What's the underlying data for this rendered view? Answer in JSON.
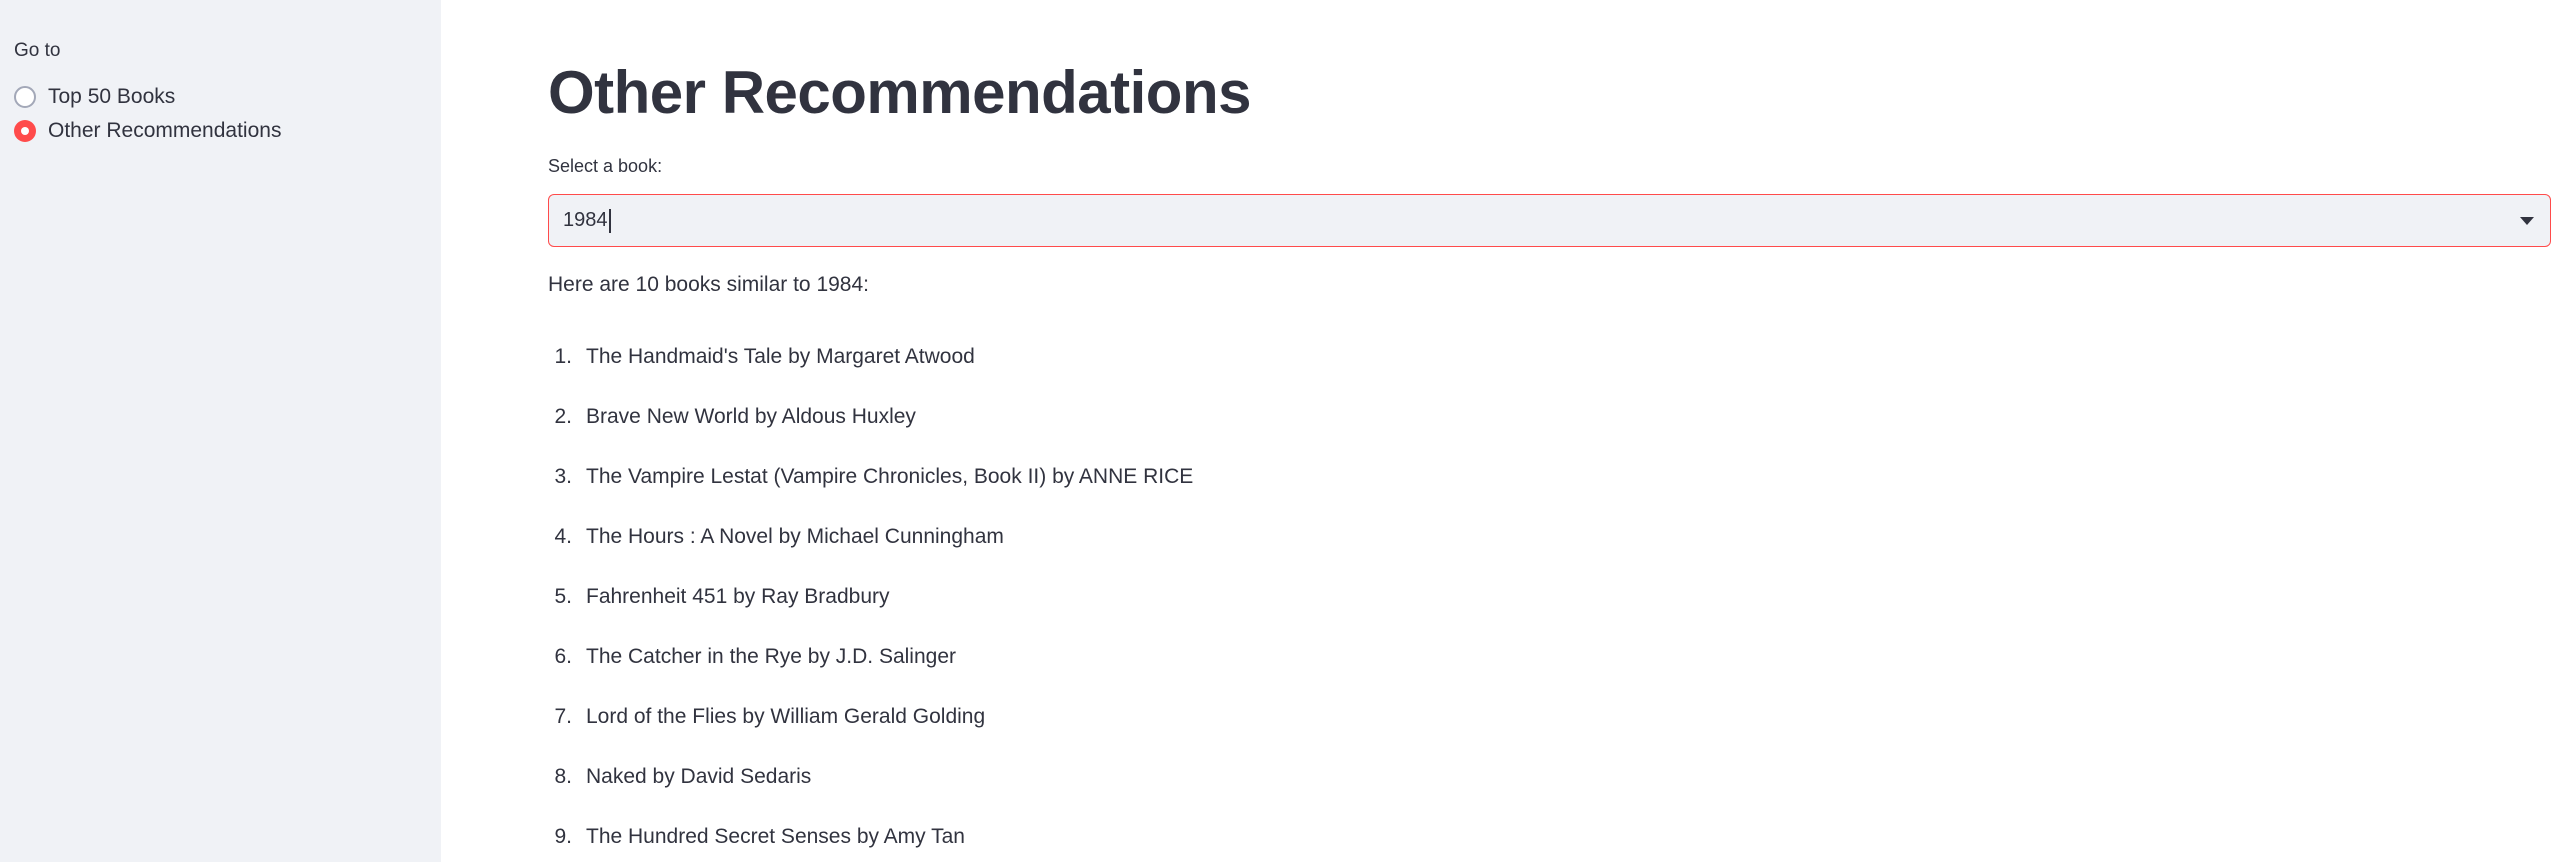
{
  "sidebar": {
    "label": "Go to",
    "options": [
      {
        "label": "Top 50 Books",
        "selected": false
      },
      {
        "label": "Other Recommendations",
        "selected": true
      }
    ]
  },
  "main": {
    "title": "Other Recommendations",
    "select_label": "Select a book:",
    "select_value": "1984",
    "intro": "Here are 10 books similar to 1984:",
    "recommendations": [
      {
        "num": "1.",
        "text": "The Handmaid's Tale by Margaret Atwood"
      },
      {
        "num": "2.",
        "text": "Brave New World by Aldous Huxley"
      },
      {
        "num": "3.",
        "text": "The Vampire Lestat (Vampire Chronicles, Book II) by ANNE RICE"
      },
      {
        "num": "4.",
        "text": "The Hours : A Novel by Michael Cunningham"
      },
      {
        "num": "5.",
        "text": "Fahrenheit 451 by Ray Bradbury"
      },
      {
        "num": "6.",
        "text": "The Catcher in the Rye by J.D. Salinger"
      },
      {
        "num": "7.",
        "text": "Lord of the Flies by William Gerald Golding"
      },
      {
        "num": "8.",
        "text": "Naked by David Sedaris"
      },
      {
        "num": "9.",
        "text": "The Hundred Secret Senses by Amy Tan"
      }
    ]
  },
  "colors": {
    "accent": "#ff4b4b",
    "sidebar_bg": "#f0f2f6",
    "text": "#31333f"
  }
}
